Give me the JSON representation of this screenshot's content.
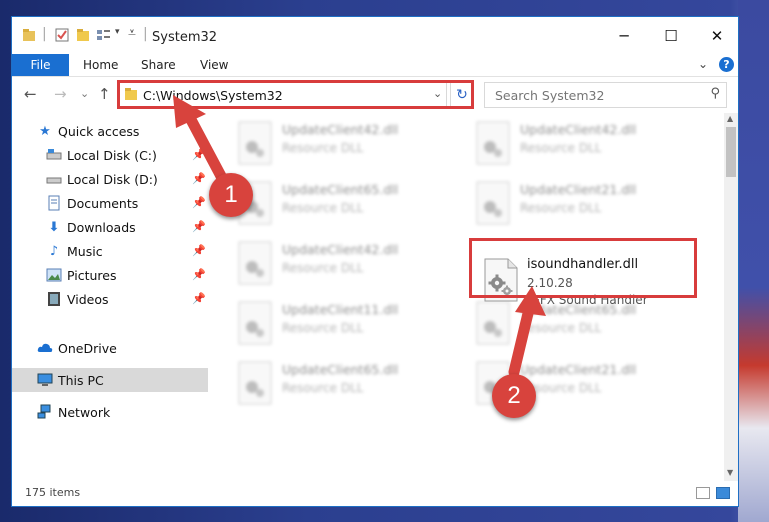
{
  "window": {
    "title": "System32",
    "minimize_glyph": "─",
    "maximize_glyph": "☐",
    "close_glyph": "✕"
  },
  "ribbon": {
    "tabs": [
      "File",
      "Home",
      "Share",
      "View"
    ],
    "help_glyph": "?"
  },
  "nav": {
    "back_glyph": "←",
    "forward_glyph": "→",
    "recent_glyph": "⌄",
    "up_glyph": "↑",
    "address": "C:\\Windows\\System32",
    "refresh_glyph": "↻",
    "search_placeholder": "Search System32"
  },
  "sidebar": {
    "items": [
      {
        "label": "Quick access",
        "icon": "star-icon",
        "pinned": false
      },
      {
        "label": "Local Disk (C:)",
        "icon": "drive-icon",
        "pinned": true
      },
      {
        "label": "Local Disk (D:)",
        "icon": "drive-icon",
        "pinned": true
      },
      {
        "label": "Documents",
        "icon": "documents-icon",
        "pinned": true
      },
      {
        "label": "Downloads",
        "icon": "download-icon",
        "pinned": true
      },
      {
        "label": "Music",
        "icon": "music-icon",
        "pinned": true
      },
      {
        "label": "Pictures",
        "icon": "pictures-icon",
        "pinned": true
      },
      {
        "label": "Videos",
        "icon": "videos-icon",
        "pinned": true
      },
      {
        "label": "OneDrive",
        "icon": "cloud-icon",
        "pinned": false
      },
      {
        "label": "This PC",
        "icon": "computer-icon",
        "pinned": false,
        "selected": true
      },
      {
        "label": "Network",
        "icon": "network-icon",
        "pinned": false
      }
    ]
  },
  "files": {
    "blurred": [
      {
        "name": "UpdateClient42.dll",
        "type": "Resource DLL"
      },
      {
        "name": "UpdateClient42.dll",
        "type": "Resource DLL"
      },
      {
        "name": "UpdateClient65.dll",
        "type": "Resource DLL"
      },
      {
        "name": "UpdateClient21.dll",
        "type": "Resource DLL"
      },
      {
        "name": "UpdateClient42.dll",
        "type": "Resource DLL"
      },
      {
        "name": "UpdateClient11.dll",
        "type": "Resource DLL"
      },
      {
        "name": "UpdateClient65.dll",
        "type": "Resource DLL"
      },
      {
        "name": "UpdateClient65.dll",
        "type": "Resource DLL"
      },
      {
        "name": "UpdateClient21.dll",
        "type": "Resource DLL"
      }
    ],
    "highlighted": {
      "name": "isoundhandler.dll",
      "version": "2.10.28",
      "description": "IGFX Sound Handler"
    }
  },
  "status": {
    "item_count": "175 items"
  },
  "callouts": [
    "1",
    "2"
  ],
  "colors": {
    "accent": "#1a6fd1",
    "highlight_box": "#d83c3c",
    "callout": "#d8433d"
  }
}
